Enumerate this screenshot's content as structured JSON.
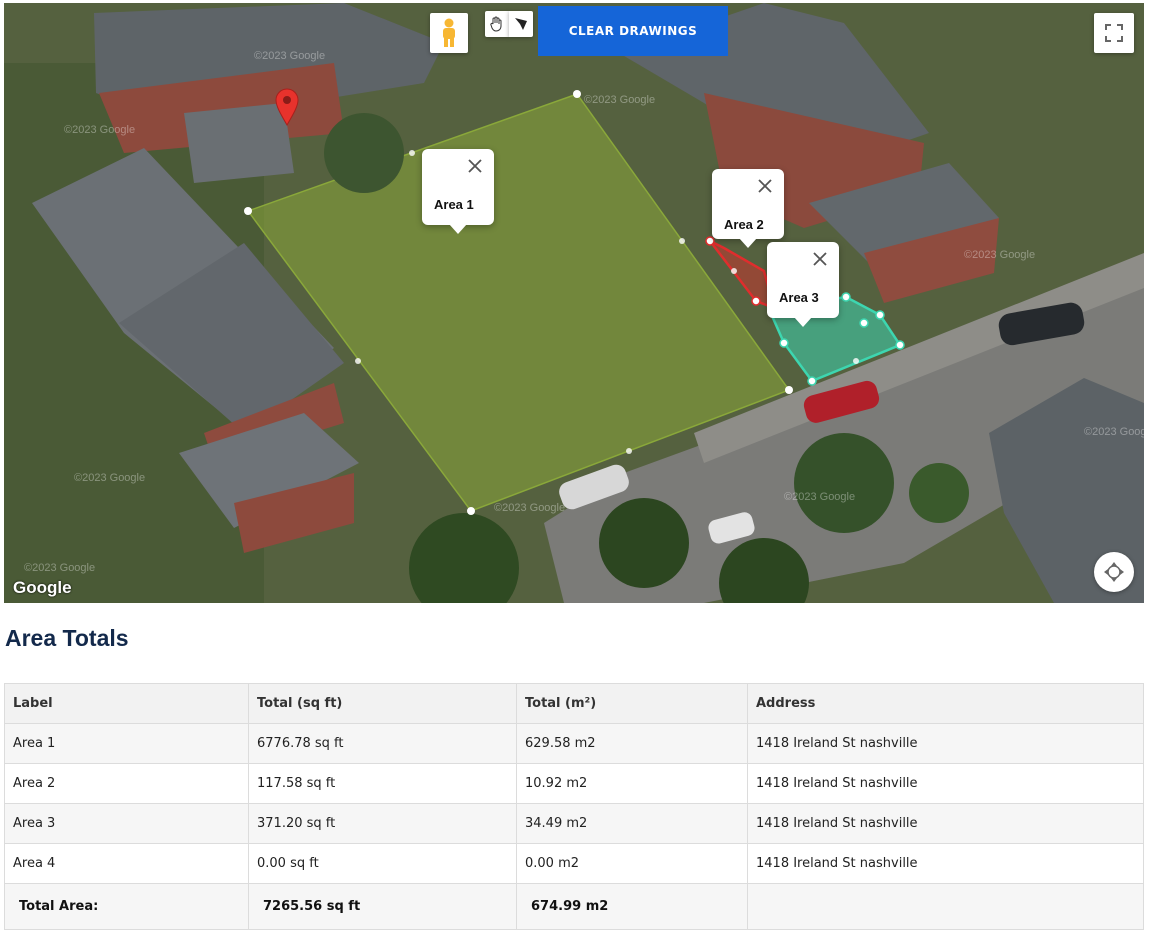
{
  "map": {
    "clear_button": "CLEAR DRAWINGS",
    "logo": "Google",
    "watermark": "©2023 Google",
    "popups": [
      "Area 1",
      "Area 2",
      "Area 3"
    ],
    "area_colors": {
      "area1": "#8aa83a",
      "area2": "#e02d2d",
      "area3": "#3dd6b0"
    }
  },
  "totals": {
    "heading": "Area Totals",
    "columns": [
      "Label",
      "Total (sq ft)",
      "Total (m²)",
      "Address"
    ],
    "rows": [
      [
        "Area 1",
        "6776.78 sq ft",
        "629.58 m2",
        "1418 Ireland St nashville"
      ],
      [
        "Area 2",
        "117.58 sq ft",
        "10.92 m2",
        "1418 Ireland St nashville"
      ],
      [
        "Area 3",
        "371.20 sq ft",
        "34.49 m2",
        "1418 Ireland St nashville"
      ],
      [
        "Area 4",
        "0.00 sq ft",
        "0.00 m2",
        "1418 Ireland St nashville"
      ]
    ],
    "total_label": "Total Area:",
    "total_sqft": "7265.56 sq ft",
    "total_m2": "674.99 m2"
  }
}
